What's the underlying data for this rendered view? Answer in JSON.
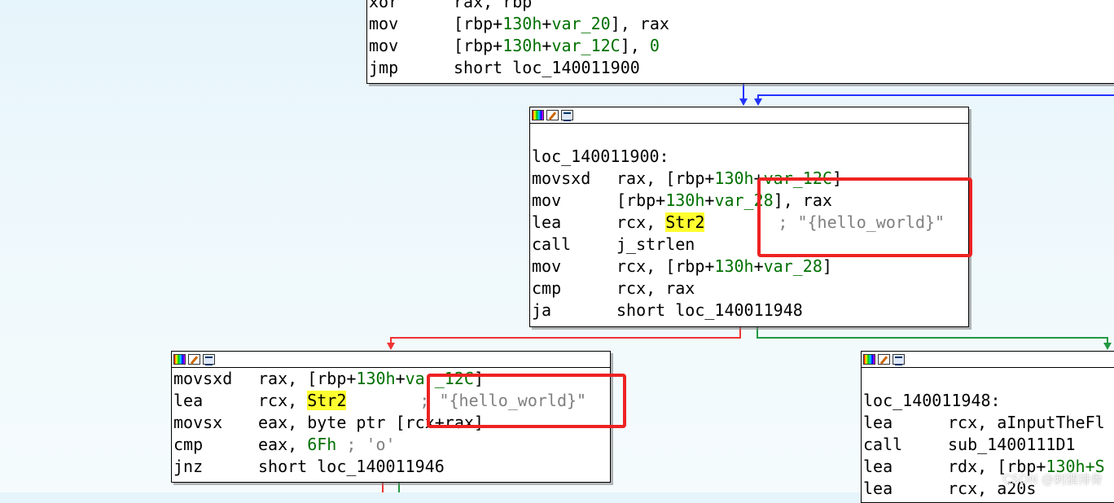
{
  "top_block": {
    "lines": [
      {
        "mn": "xor",
        "ops": "rax, rbp"
      },
      {
        "mn": "mov",
        "ops_a": "[rbp+",
        "num": "130h",
        "ops_b": "+",
        "var": "var_20",
        "ops_c": "], rax"
      },
      {
        "mn": "mov",
        "ops_a": "[rbp+",
        "num": "130h",
        "ops_b": "+",
        "var": "var_12C",
        "ops_c": "], ",
        "num2": "0"
      },
      {
        "mn": "jmp",
        "ops": "short loc_140011900"
      }
    ]
  },
  "middle_block": {
    "label": "loc_140011900:",
    "lines": [
      {
        "mn": "movsxd",
        "ops_a": "rax, [rbp+",
        "num": "130h",
        "ops_b": "+",
        "var": "var_12C",
        "ops_c": "]"
      },
      {
        "mn": "mov",
        "ops_a": "[rbp+",
        "num": "130h",
        "ops_b": "+",
        "var": "var_28",
        "ops_c": "], rax"
      },
      {
        "mn": "lea",
        "ops_a": "rcx, ",
        "hl": "Str2",
        "cmt": "; \"{hello_world}\""
      },
      {
        "mn": "call",
        "ops": "j_strlen"
      },
      {
        "mn": "mov",
        "ops_a": "rcx, [rbp+",
        "num": "130h",
        "ops_b": "+",
        "var": "var_28",
        "ops_c": "]"
      },
      {
        "mn": "cmp",
        "ops": "rcx, rax"
      },
      {
        "mn": "ja",
        "ops": "short loc_140011948"
      }
    ]
  },
  "left_block": {
    "lines": [
      {
        "mn": "movsxd",
        "ops_a": "rax, [rbp+",
        "num": "130h",
        "ops_b": "+",
        "var": "var_12C",
        "ops_c": "]"
      },
      {
        "mn": "lea",
        "ops_a": "rcx, ",
        "hl": "Str2",
        "cmt": "; \"{hello_world}\""
      },
      {
        "mn": "movsx",
        "ops": "eax, byte ptr [rcx+rax]"
      },
      {
        "mn": "cmp",
        "ops_a": "eax, ",
        "num": "6Fh",
        "cmt": " ; 'o'"
      },
      {
        "mn": "jnz",
        "ops": "short loc_140011946"
      }
    ]
  },
  "right_block": {
    "label": "loc_140011948:",
    "lines": [
      {
        "mn": "lea",
        "ops": "rcx, aInputTheFl"
      },
      {
        "mn": "call",
        "ops": "sub_1400111D1"
      },
      {
        "mn": "lea",
        "ops_a": "rdx, [rbp+",
        "num": "130h",
        "ops_b": "+S"
      },
      {
        "mn": "lea",
        "ops": "rcx, a20s"
      }
    ]
  },
  "watermark": "CSDN @刺猬排骨",
  "colors": {
    "edge_blue": "#2233ff",
    "edge_red": "#ee3333",
    "edge_green": "#229944",
    "highlight": "#ffff30",
    "annotation_box": "#e22222"
  }
}
